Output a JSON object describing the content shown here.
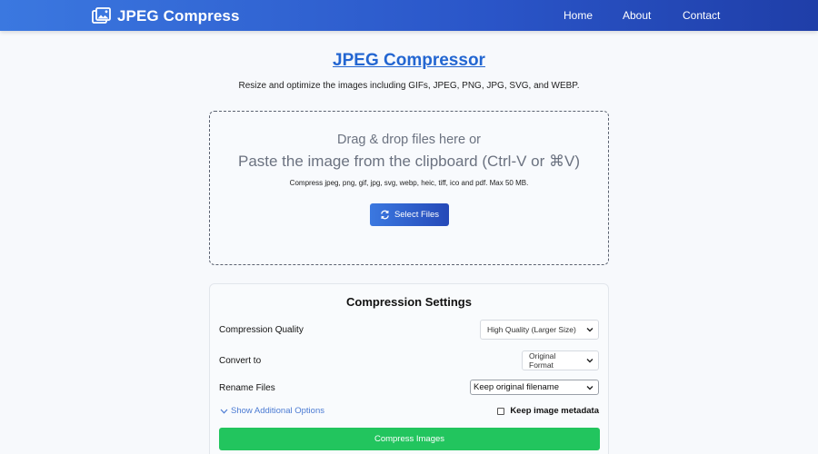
{
  "navbar": {
    "brand": "JPEG Compress",
    "brand_icon": "images-icon",
    "links": [
      {
        "label": "Home"
      },
      {
        "label": "About"
      },
      {
        "label": "Contact"
      }
    ]
  },
  "main": {
    "title": "JPEG Compressor",
    "subtitle": "Resize and optimize the images including GIFs, JPEG, PNG, JPG, SVG, and WEBP."
  },
  "dropzone": {
    "line1": "Drag & drop files here or",
    "line2": "Paste the image from the clipboard (Ctrl-V or ⌘V)",
    "hint": "Compress jpeg, png, gif, jpg, svg, webp, heic, tiff, ico and pdf. Max 50 MB.",
    "button_label": "Select Files",
    "button_icon": "sync-icon"
  },
  "settings": {
    "title": "Compression Settings",
    "quality": {
      "label": "Compression Quality",
      "value": "High Quality (Larger Size)"
    },
    "convert": {
      "label": "Convert to",
      "value": "Original Format"
    },
    "rename": {
      "label": "Rename Files",
      "value": "Keep original filename"
    },
    "show_options": "Show Additional Options",
    "metadata": {
      "label": "Keep image metadata",
      "checked": false
    },
    "compress_button": "Compress Images"
  },
  "colors": {
    "nav_gradient_start": "#3b78e0",
    "nav_gradient_end": "#1f3ea8",
    "title_link": "#2366d1",
    "compress_button": "#22c55e"
  }
}
